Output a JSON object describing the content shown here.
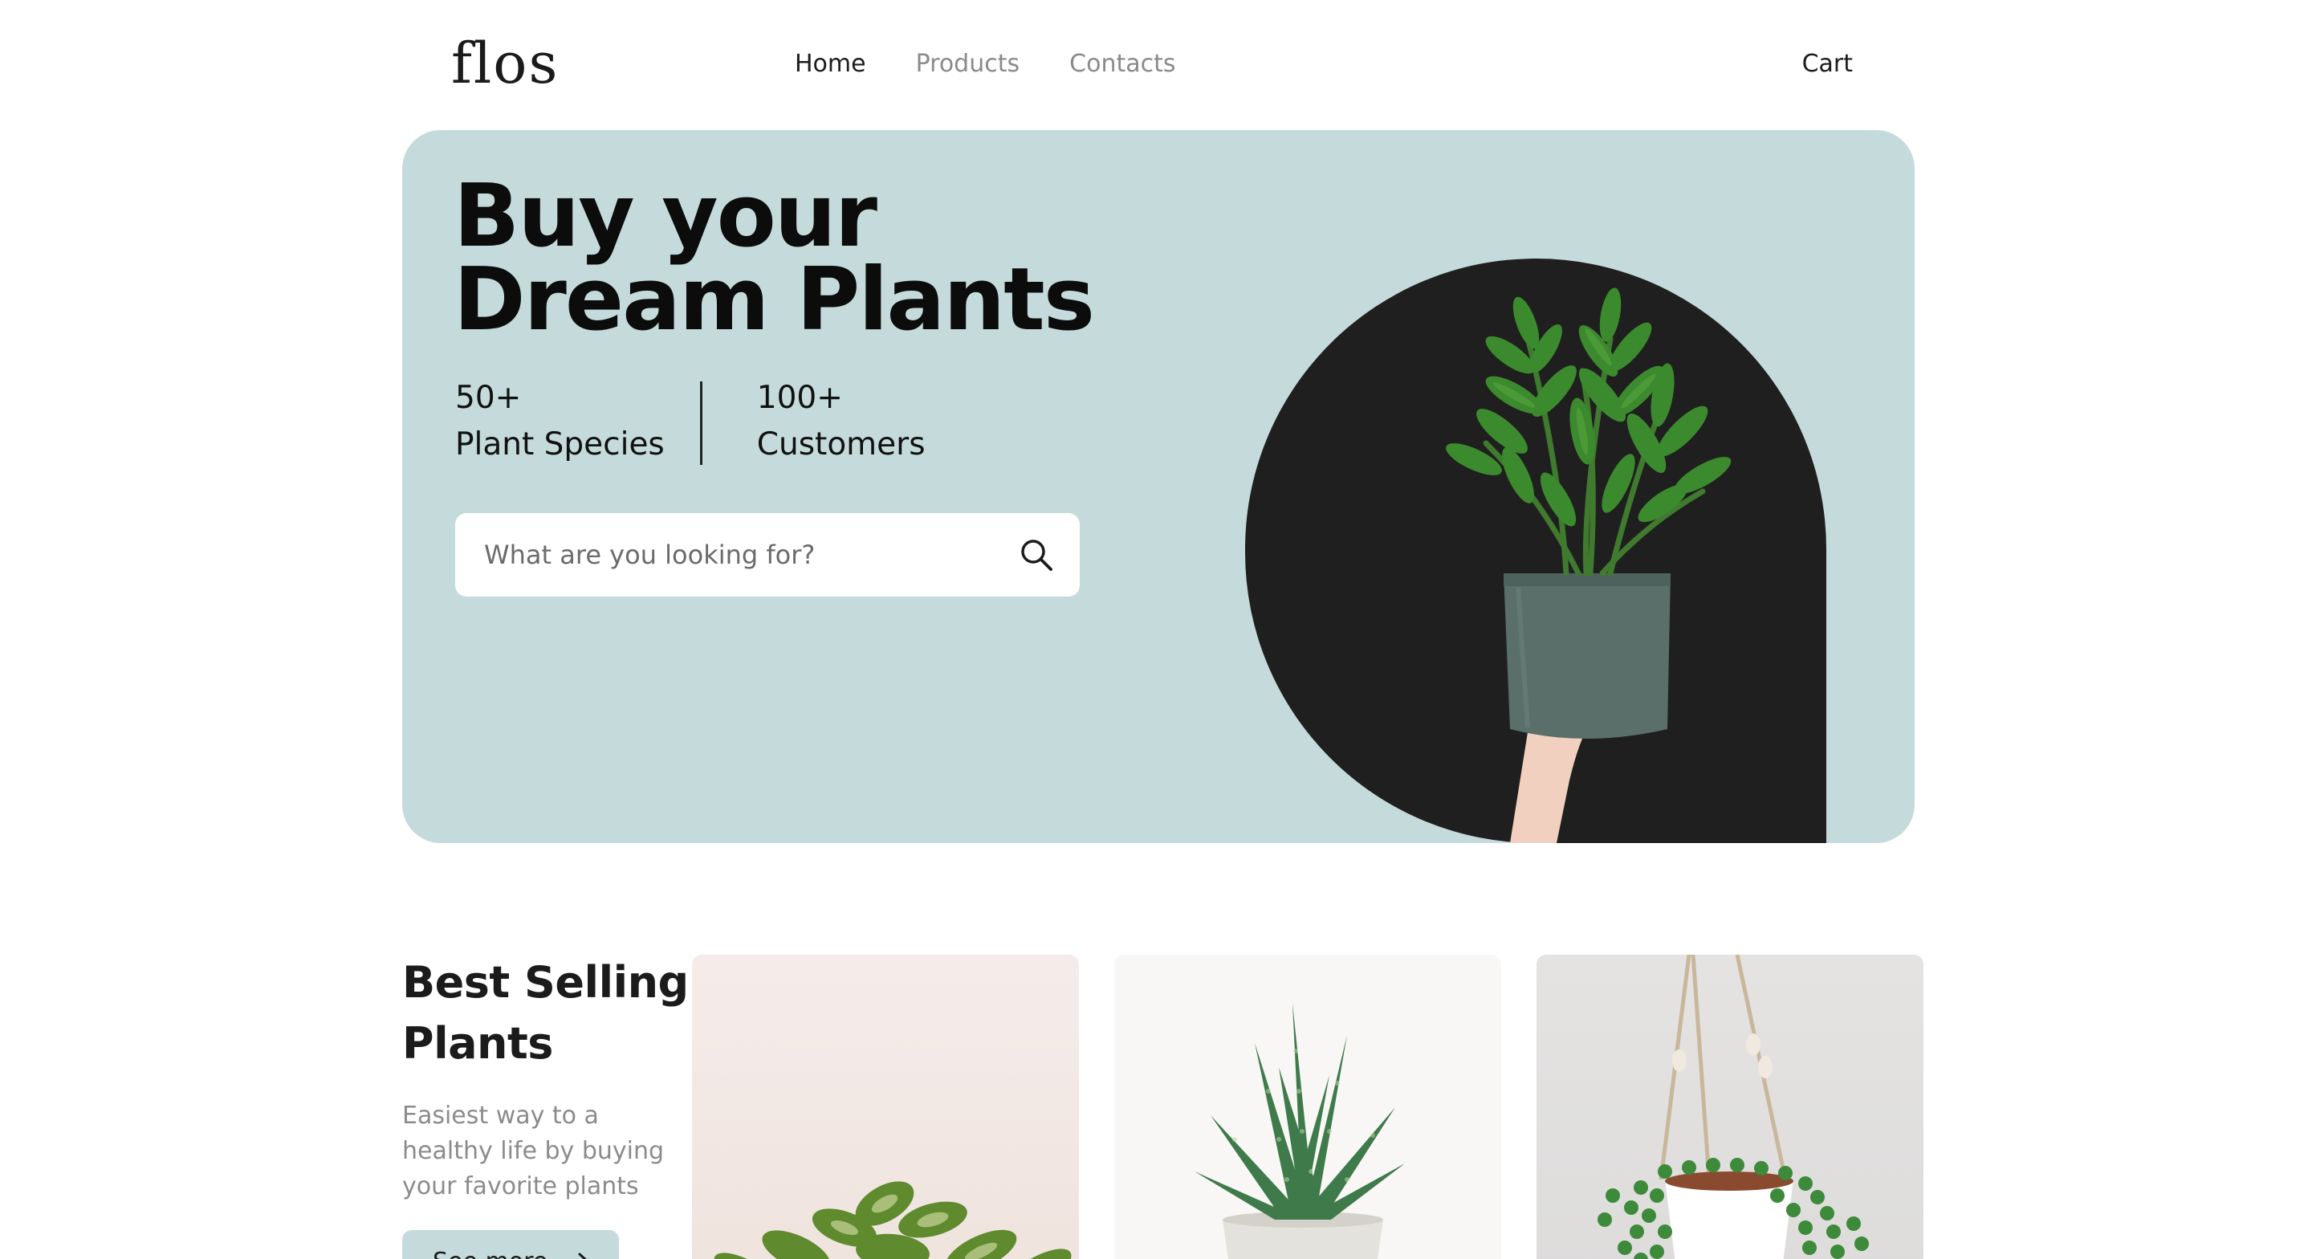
{
  "header": {
    "logo": "flos",
    "nav": [
      {
        "label": "Home",
        "active": true
      },
      {
        "label": "Products",
        "active": false
      },
      {
        "label": "Contacts",
        "active": false
      }
    ],
    "cart_label": "Cart"
  },
  "hero": {
    "title_line1": "Buy your",
    "title_line2": "Dream Plants",
    "stats": [
      {
        "value": "50+",
        "label": "Plant Species"
      },
      {
        "value": "100+",
        "label": "Customers"
      }
    ],
    "search_placeholder": "What are you looking for?",
    "search_icon": "search-icon",
    "background_color": "#c5dbdb",
    "accent_dark": "#1f1f1f"
  },
  "best_selling": {
    "title_line1": "Best Selling",
    "title_line2": "Plants",
    "description": "Easiest way to a healthy life by buying your favorite plants",
    "button_label": "See more",
    "button_icon": "arrow-right-icon",
    "products": [
      {
        "image": "pothos-plant"
      },
      {
        "image": "aloe-succulent-plant"
      },
      {
        "image": "string-of-pearls-hanging-plant"
      }
    ]
  }
}
